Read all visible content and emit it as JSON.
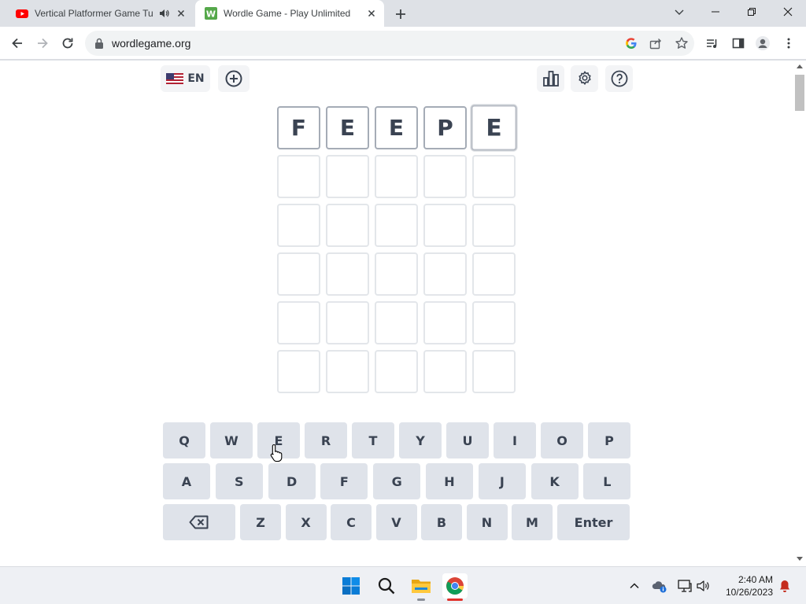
{
  "browser": {
    "tabs": [
      {
        "title": "Vertical Platformer Game Tu",
        "favicon": "youtube-icon",
        "audio": "speaker-icon",
        "active": false
      },
      {
        "title": "Wordle Game - Play Unlimited",
        "favicon": "wordle-w-icon",
        "favicon_letter": "W",
        "active": true
      }
    ],
    "url": "wordlegame.org",
    "colors": {
      "tab_strip": "#dee1e6",
      "youtube_red": "#ff0000",
      "wordle_green": "#55a84a"
    }
  },
  "wordle": {
    "language": "EN",
    "board": [
      [
        "F",
        "E",
        "E",
        "P",
        "E"
      ],
      [
        "",
        "",
        "",
        "",
        ""
      ],
      [
        "",
        "",
        "",
        "",
        ""
      ],
      [
        "",
        "",
        "",
        "",
        ""
      ],
      [
        "",
        "",
        "",
        "",
        ""
      ],
      [
        "",
        "",
        "",
        "",
        ""
      ]
    ],
    "keyboard": {
      "row1": [
        "Q",
        "W",
        "E",
        "R",
        "T",
        "Y",
        "U",
        "I",
        "O",
        "P"
      ],
      "row2": [
        "A",
        "S",
        "D",
        "F",
        "G",
        "H",
        "J",
        "K",
        "L"
      ],
      "row3": [
        "Z",
        "X",
        "C",
        "V",
        "B",
        "N",
        "M"
      ],
      "enter": "Enter"
    },
    "colors": {
      "text": "#3a4352",
      "key_bg": "#dfe3ea",
      "tile_border": "#e3e6ea",
      "tile_filled_border": "#a5acb6"
    }
  },
  "taskbar": {
    "time": "2:40 AM",
    "date": "10/26/2023"
  }
}
